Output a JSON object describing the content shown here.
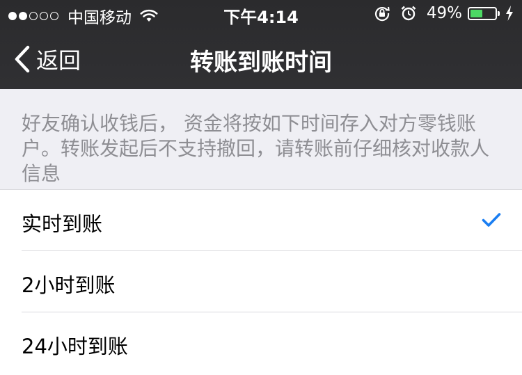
{
  "status_bar": {
    "carrier": "中国移动",
    "time": "下午4:14",
    "battery_text": "49%",
    "battery_level": 0.49,
    "signal_dots_filled": 2,
    "signal_dots_total": 5,
    "icons": [
      "wifi-icon",
      "orientation-lock-icon",
      "alarm-icon",
      "battery-icon",
      "charging-bolt-icon"
    ]
  },
  "nav": {
    "back_label": "返回",
    "title": "转账到账时间"
  },
  "description": "好友确认收钱后， 资金将按如下时间存入对方零钱账户。转账发起后不支持撤回，请转账前仔细核对收款人信息",
  "options": [
    {
      "label": "实时到账",
      "selected": true
    },
    {
      "label": "2小时到账",
      "selected": false
    },
    {
      "label": "24小时到账",
      "selected": false
    }
  ],
  "colors": {
    "header_bg": "#2b2b2d",
    "page_bg": "#efeff4",
    "check_blue": "#1a7ef2",
    "battery_green": "#4cd964"
  }
}
